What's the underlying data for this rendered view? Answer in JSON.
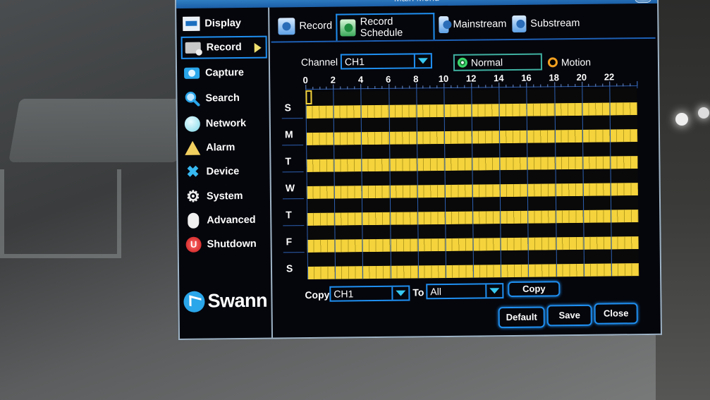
{
  "window": {
    "title": "Main Menu",
    "close_icon": "close-icon"
  },
  "sidebar": {
    "items": [
      {
        "label": "Display",
        "icon": "display-icon",
        "active": false
      },
      {
        "label": "Record",
        "icon": "record-icon",
        "active": true
      },
      {
        "label": "Capture",
        "icon": "camera-icon",
        "active": false
      },
      {
        "label": "Search",
        "icon": "search-icon",
        "active": false
      },
      {
        "label": "Network",
        "icon": "network-icon",
        "active": false
      },
      {
        "label": "Alarm",
        "icon": "alarm-icon",
        "active": false
      },
      {
        "label": "Device",
        "icon": "device-icon",
        "active": false
      },
      {
        "label": "System",
        "icon": "gear-icon",
        "active": false
      },
      {
        "label": "Advanced",
        "icon": "mouse-icon",
        "active": false
      },
      {
        "label": "Shutdown",
        "icon": "power-icon",
        "active": false
      }
    ],
    "logo": "Swann"
  },
  "tabs": [
    {
      "label": "Record",
      "active": false
    },
    {
      "label": "Record Schedule",
      "active": true
    },
    {
      "label": "Mainstream",
      "active": false
    },
    {
      "label": "Substream",
      "active": false
    }
  ],
  "controls": {
    "channel_label": "Channel",
    "channel_value": "CH1",
    "mode_normal": "Normal",
    "mode_motion": "Motion",
    "mode_selected": "Normal"
  },
  "schedule": {
    "hour_labels": [
      "0",
      "2",
      "4",
      "6",
      "8",
      "10",
      "12",
      "14",
      "16",
      "18",
      "20",
      "22"
    ],
    "days": [
      "S",
      "M",
      "T",
      "W",
      "T",
      "F",
      "S"
    ],
    "normal_hours": [
      [
        0,
        24
      ],
      [
        0,
        24
      ],
      [
        0,
        24
      ],
      [
        0,
        24
      ],
      [
        0,
        24
      ],
      [
        0,
        24
      ],
      [
        0,
        24
      ]
    ],
    "motion_hours": [
      [],
      [],
      [],
      [],
      [],
      [],
      []
    ],
    "colors": {
      "normal": "#f4d33c",
      "motion": "#090909"
    }
  },
  "copy": {
    "copy_label": "Copy",
    "from_value": "CH1",
    "to_label": "To",
    "to_value": "All",
    "copy_button": "Copy"
  },
  "footer": {
    "default_button": "Default",
    "save_button": "Save",
    "close_button": "Close"
  }
}
